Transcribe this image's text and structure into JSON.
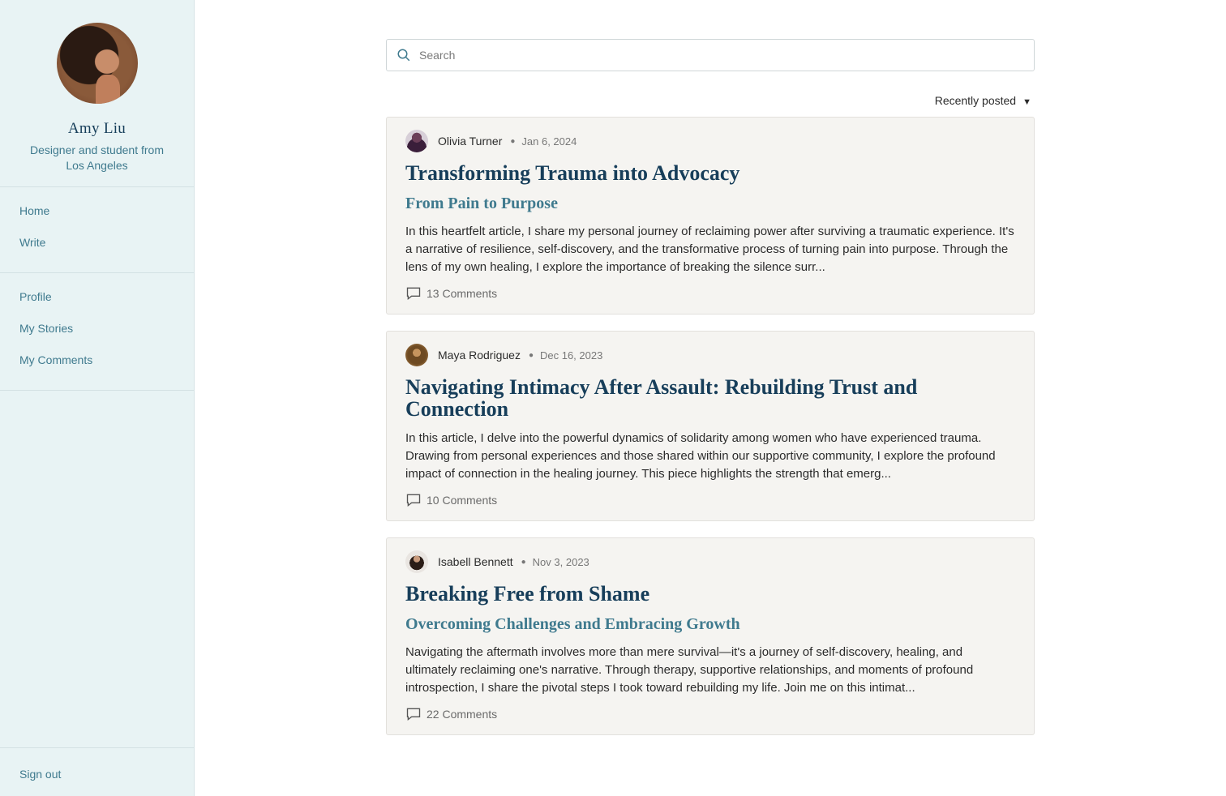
{
  "sidebar": {
    "profile": {
      "name": "Amy Liu",
      "bio": "Designer and student from Los Angeles"
    },
    "nav_primary": [
      {
        "label": "Home"
      },
      {
        "label": "Write"
      }
    ],
    "nav_secondary": [
      {
        "label": "Profile"
      },
      {
        "label": "My Stories"
      },
      {
        "label": "My Comments"
      }
    ],
    "signout_label": "Sign out"
  },
  "search": {
    "placeholder": "Search",
    "value": ""
  },
  "sort": {
    "label": "Recently posted"
  },
  "posts": [
    {
      "author": "Olivia Turner",
      "date": "Jan 6, 2024",
      "title": "Transforming Trauma into Advocacy",
      "subtitle": "From Pain to Purpose",
      "excerpt": "In this heartfelt article, I share my personal journey of reclaiming power after surviving a traumatic experience. It's a narrative of resilience, self-discovery, and the transformative process of turning pain into purpose. Through the lens of my own healing, I explore the importance of breaking the silence surr...",
      "comments": "13 Comments"
    },
    {
      "author": "Maya Rodriguez",
      "date": "Dec 16, 2023",
      "title": "Navigating Intimacy After Assault: Rebuilding Trust and Connection",
      "subtitle": "",
      "excerpt": "In this article, I delve into the powerful dynamics of solidarity among women who have experienced trauma. Drawing from personal experiences and those shared within our supportive community, I explore the profound impact of connection in the healing journey. This piece highlights the strength that emerg...",
      "comments": "10 Comments"
    },
    {
      "author": "Isabell Bennett",
      "date": "Nov 3, 2023",
      "title": "Breaking Free from Shame",
      "subtitle": "Overcoming Challenges and Embracing Growth",
      "excerpt": "Navigating the aftermath involves more than mere survival—it's a journey of self-discovery, healing, and ultimately reclaiming one's narrative. Through therapy, supportive relationships, and moments of profound introspection, I share the pivotal steps I took toward rebuilding my life. Join me on this intimat...",
      "comments": "22 Comments"
    }
  ]
}
